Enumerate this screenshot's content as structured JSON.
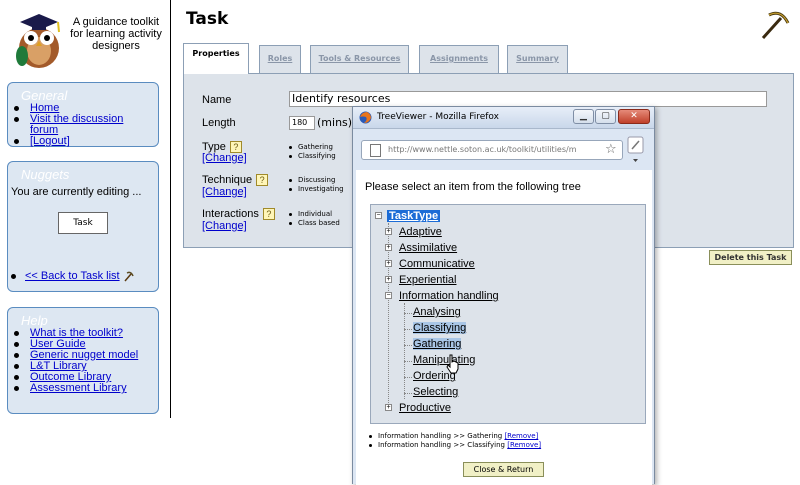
{
  "logo": {
    "text": "A guidance toolkit for learning activity designers"
  },
  "sidebar": {
    "general": {
      "title": "General",
      "links": [
        "Home",
        "Visit the discussion forum",
        "[Logout]"
      ]
    },
    "nuggets": {
      "title": "Nuggets",
      "editing_text": "You are currently editing ...",
      "task_button": "Task",
      "back_link": "<< Back to Task list"
    },
    "help": {
      "title": "Help",
      "links": [
        "What is the toolkit?",
        "User Guide",
        "Generic nugget model",
        "L&T Library",
        "Outcome Library",
        "Assessment Library"
      ]
    }
  },
  "main": {
    "title": "Task",
    "tabs": [
      "Properties",
      "Roles",
      "Tools & Resources",
      "Assignments",
      "Summary"
    ],
    "active_tab": "Properties",
    "form": {
      "name_label": "Name",
      "name_value": "Identify resources",
      "length_label": "Length",
      "length_value": "180",
      "length_unit": "(mins)",
      "type_label": "Type",
      "type_values": [
        "Gathering",
        "Classifying"
      ],
      "technique_label": "Technique",
      "technique_values": [
        "Discussing",
        "Investigating"
      ],
      "interactions_label": "Interactions",
      "interactions_values": [
        "Individual",
        "Class based"
      ],
      "change_label": "[Change]",
      "help_glyph": "?"
    },
    "delete_button": "Delete this Task"
  },
  "popup": {
    "window_title": "TreeViewer - Mozilla Firefox",
    "url": "http://www.nettle.soton.ac.uk/toolkit/utilities/m",
    "prompt": "Please select an item from the following tree",
    "tree": {
      "root": "TaskType",
      "children": [
        "Adaptive",
        "Assimilative",
        "Communicative",
        "Experiential",
        "Information handling"
      ],
      "info_children": [
        "Analysing",
        "Classifying",
        "Gathering",
        "Manipulating",
        "Ordering",
        "Selecting"
      ],
      "last": "Productive",
      "expand_glyph": "+",
      "collapse_glyph": "−"
    },
    "selected": [
      {
        "text": "Information handling >> Gathering",
        "remove": "[Remove]"
      },
      {
        "text": "Information handling >> Classifying",
        "remove": "[Remove]"
      }
    ],
    "close_button": "Close & Return",
    "buttons": {
      "min": "▁",
      "max": "▢",
      "close": "✕"
    }
  },
  "colors": {
    "panel_bg": "#dde7f2",
    "panel_border": "#5a8cc0",
    "content_bg": "#dde3ea",
    "button_bg": "#f1f0c6",
    "link": "#0000cc",
    "selection": "#1c6cd6"
  }
}
